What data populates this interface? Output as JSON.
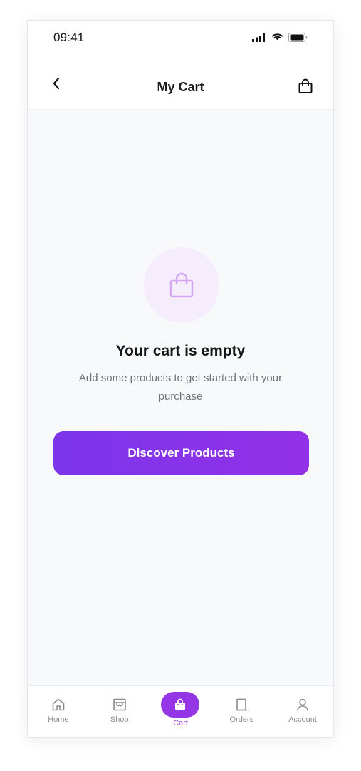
{
  "status_bar": {
    "time": "09:41"
  },
  "nav": {
    "title": "My Cart"
  },
  "empty_state": {
    "title": "Your cart is empty",
    "subtitle": "Add some products to get started with your purchase",
    "cta_label": "Discover Products"
  },
  "tabs": [
    {
      "label": "Home",
      "icon": "home-icon"
    },
    {
      "label": "Shop",
      "icon": "store-icon"
    },
    {
      "label": "Cart",
      "icon": "shopping-bag-icon",
      "active": true
    },
    {
      "label": "Orders",
      "icon": "receipt-icon"
    },
    {
      "label": "Account",
      "icon": "user-icon"
    }
  ],
  "colors": {
    "accent": "#9436e6",
    "gradient_start": "#7b35ea",
    "gradient_end": "#9331e8",
    "background": "#f8f9fb"
  }
}
